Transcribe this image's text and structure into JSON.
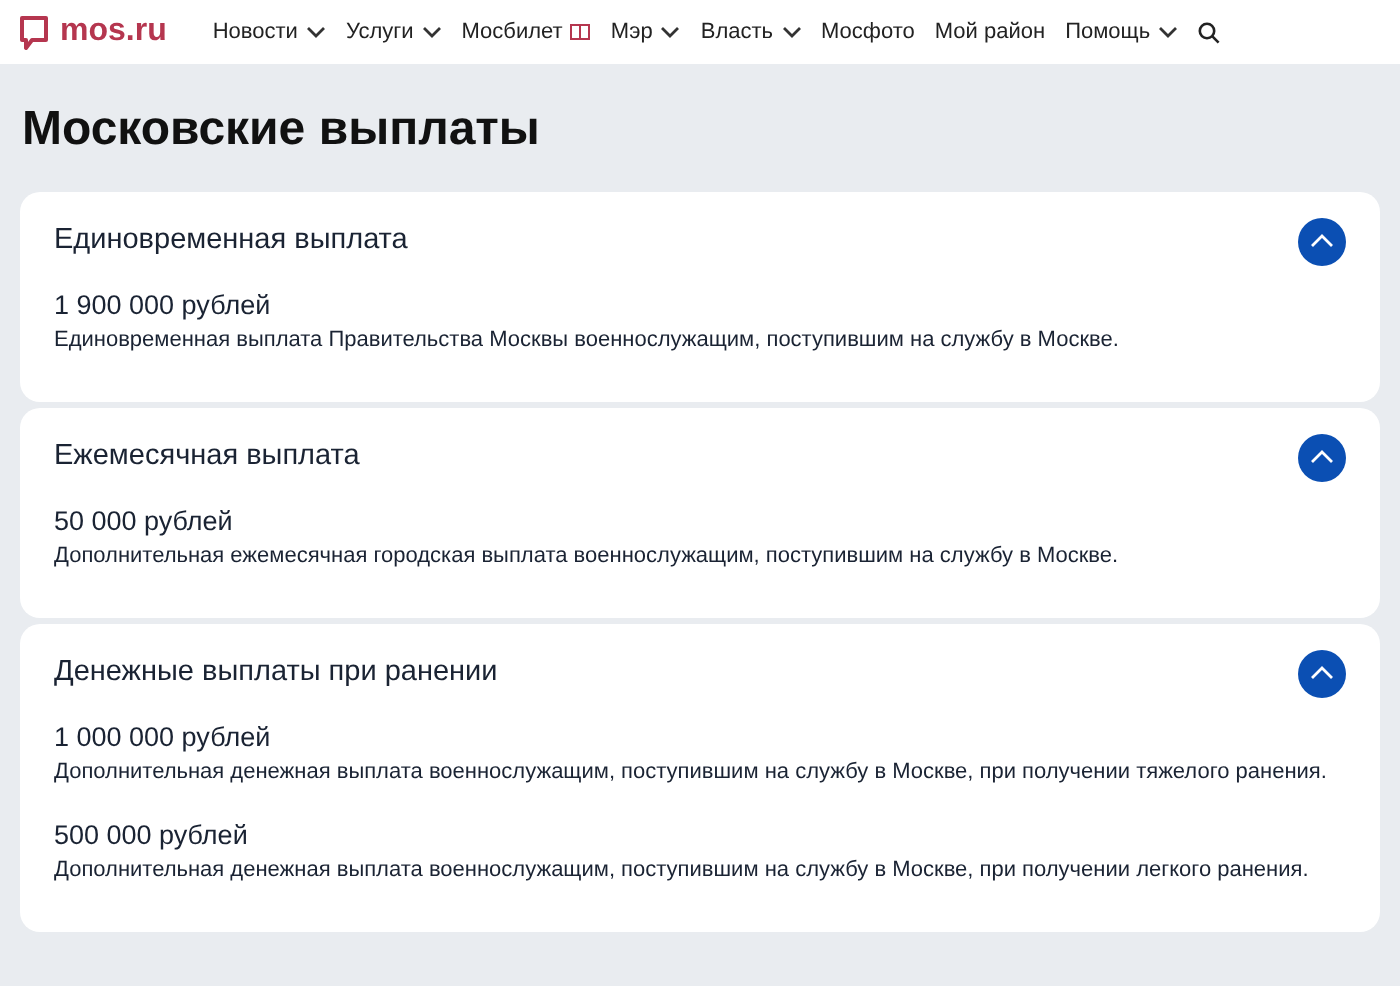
{
  "header": {
    "logo": "mos.ru",
    "nav": [
      {
        "label": "Новости",
        "kind": "dropdown"
      },
      {
        "label": "Услуги",
        "kind": "dropdown"
      },
      {
        "label": "Мосбилет",
        "kind": "ticket"
      },
      {
        "label": "Мэр",
        "kind": "dropdown"
      },
      {
        "label": "Власть",
        "kind": "dropdown"
      },
      {
        "label": "Мосфото",
        "kind": "link"
      },
      {
        "label": "Мой район",
        "kind": "link"
      },
      {
        "label": "Помощь",
        "kind": "dropdown"
      }
    ]
  },
  "page_title": "Московские выплаты",
  "sections": [
    {
      "title": "Единовременная выплата",
      "expanded": true,
      "items": [
        {
          "amount": "1 900 000 рублей",
          "description": "Единовременная выплата Правительства Москвы военнослужащим, поступившим на службу в Москве."
        }
      ]
    },
    {
      "title": "Ежемесячная выплата",
      "expanded": true,
      "items": [
        {
          "amount": "50 000 рублей",
          "description": "Дополнительная ежемесячная городская выплата военнослужащим, поступившим на службу в Москве."
        }
      ]
    },
    {
      "title": "Денежные выплаты при ранении",
      "expanded": true,
      "items": [
        {
          "amount": "1 000 000 рублей",
          "description": "Дополнительная денежная выплата военнослужащим, поступившим на службу в Москве, при получении тяжелого ранения."
        },
        {
          "amount": "500 000 рублей",
          "description": "Дополнительная денежная выплата военнослужащим, поступившим на службу в Москве, при получении легкого ранения."
        }
      ]
    }
  ]
}
